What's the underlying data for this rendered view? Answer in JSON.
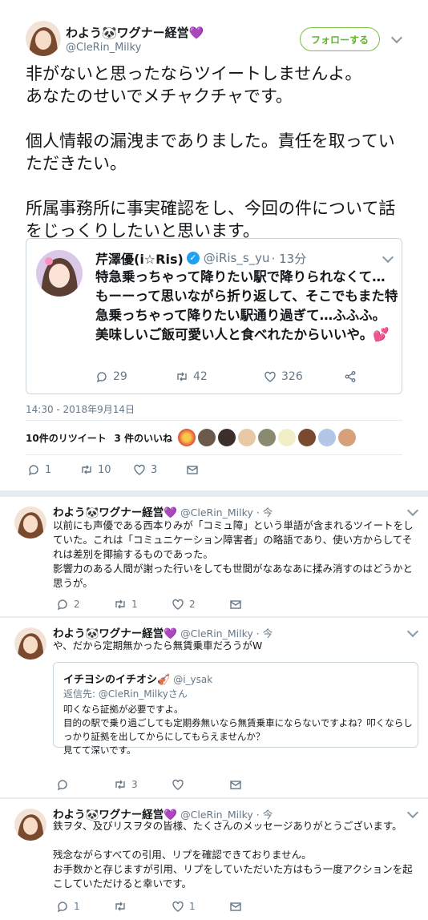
{
  "main_tweet": {
    "author_name": "わよう🐼ワグナー経営💜",
    "author_handle": "@CleRin_Milky",
    "follow_label": "フォローする",
    "text": "非がないと思ったならツイートしませんよ。\nあなたのせいでメチャクチャです。\n\n個人情報の漏洩までありました。責任を取っていただきたい。\n\n所属事務所に事実確認をし、今回の件について話をじっくりしたいと思います。",
    "quote": {
      "author_name": "芹澤優(i☆Ris)",
      "author_handle": "@iRis_s_yu",
      "time": "· 13分",
      "text": "特急乗っちゃって降りたい駅で降りられなくて…もーーって思いながら折り返して、そこでもまた特急乗っちゃって降りたい駅通り過ぎて…ふふふ。美味しいご飯可愛い人と食べれたからいいや。💕",
      "replies": "29",
      "retweets": "42",
      "likes": "326"
    },
    "timestamp": "14:30 - 2018年9月14日",
    "retweets_count": "10件のリツイート",
    "likes_count": "3 件のいいね",
    "actions": {
      "replies": "1",
      "retweets": "10",
      "likes": "3"
    }
  },
  "replies": [
    {
      "author_name": "わよう🐼ワグナー経営💜",
      "author_handle": "@CleRin_Milky",
      "time": "· 今",
      "text": "以前にも声優である西本りみが「コミュ障」という単語が含まれるツイートをしていた。これは「コミュニケーション障害者」の略語であり、使い方からしてそれは差別を揶揄するものであった。\n影響力のある人間が謝った行いをしても世間がなあなあに揉み消すのはどうかと思うが。",
      "counts": {
        "replies": "2",
        "retweets": "1",
        "likes": "2"
      }
    },
    {
      "author_name": "わよう🐼ワグナー経営💜",
      "author_handle": "@CleRin_Milky",
      "time": "· 今",
      "text": "や、だから定期無かったら無賃乗車だろうがW",
      "quote": {
        "author_name": "イチヨシのイチオシ🎻",
        "author_handle": "@i_ysak",
        "reply_to": "返信先: @CleRin_Milkyさん",
        "text": "叩くなら証拠が必要ですよ。\n目的の駅で乗り過ごしても定期券無いなら無賃乗車にならないですよね？叩くならしっかり証拠を出してからにしてもらえませんか？\n見てて深いです。"
      },
      "counts": {
        "replies": "",
        "retweets": "3",
        "likes": ""
      }
    },
    {
      "author_name": "わよう🐼ワグナー経営💜",
      "author_handle": "@CleRin_Milky",
      "time": "· 今",
      "text": "鉄ヲタ、及びリスヲタの皆様、たくさんのメッセージありがとうございます。\n\n残念ながらすべての引用、リプを確認できておりません。\nお手数かと存じますが引用、リプをしていただいた方はもう一度アクションを起こしていただけると幸いです。",
      "counts": {
        "replies": "1",
        "retweets": "",
        "likes": "1"
      }
    }
  ],
  "colors": {
    "accent": "#7bc142",
    "link": "#1da1f2",
    "muted": "#657786"
  }
}
